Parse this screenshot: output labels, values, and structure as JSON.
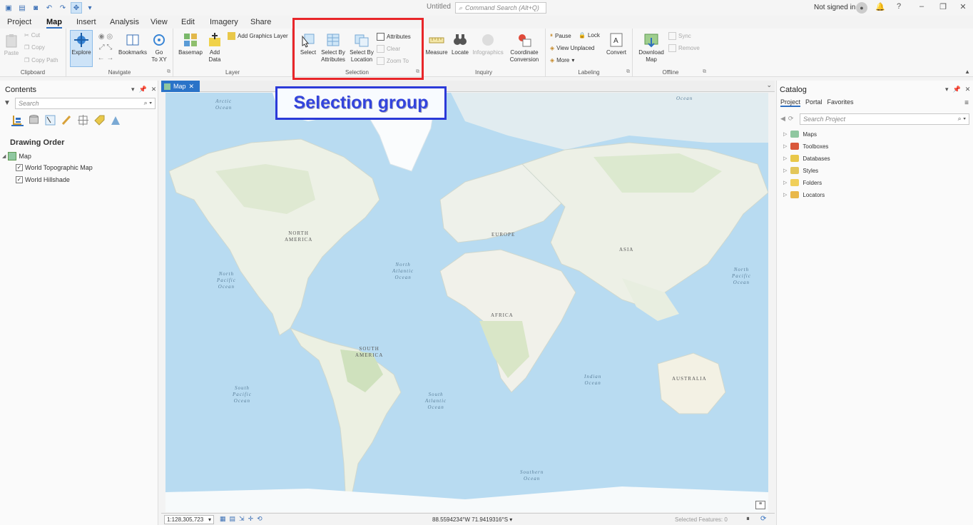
{
  "window": {
    "title": "Untitled",
    "command_search_placeholder": "Command Search (Alt+Q)",
    "signin_text": "Not signed in"
  },
  "tabs": [
    "Project",
    "Map",
    "Insert",
    "Analysis",
    "View",
    "Edit",
    "Imagery",
    "Share"
  ],
  "active_tab": "Map",
  "ribbon": {
    "clipboard": {
      "label": "Clipboard",
      "paste": "Paste",
      "cut": "Cut",
      "copy": "Copy",
      "copy_path": "Copy Path"
    },
    "navigate": {
      "label": "Navigate",
      "explore": "Explore",
      "bookmarks": "Bookmarks",
      "go_to": "Go",
      "go_to_2": "To XY"
    },
    "layer": {
      "label": "Layer",
      "basemap": "Basemap",
      "add": "Add",
      "add_2": "Data",
      "add_graphics_layer": "Add Graphics Layer"
    },
    "selection": {
      "label": "Selection",
      "select": "Select",
      "select_by_attr_1": "Select By",
      "select_by_attr_2": "Attributes",
      "select_by_loc_1": "Select By",
      "select_by_loc_2": "Location",
      "attributes": "Attributes",
      "clear": "Clear",
      "zoom_to": "Zoom To"
    },
    "inquiry": {
      "label": "Inquiry",
      "measure": "Measure",
      "locate": "Locate",
      "infographics": "Infographics",
      "coord_1": "Coordinate",
      "coord_2": "Conversion"
    },
    "labeling": {
      "label": "Labeling",
      "pause": "Pause",
      "lock": "Lock",
      "view_unplaced": "View Unplaced",
      "more": "More",
      "convert": "Convert"
    },
    "offline": {
      "label": "Offline",
      "download_1": "Download",
      "download_2": "Map",
      "sync": "Sync",
      "remove": "Remove"
    }
  },
  "annotation": {
    "callout_text": "Selection group"
  },
  "contents": {
    "title": "Contents",
    "search_placeholder": "Search",
    "drawing_order": "Drawing Order",
    "map_name": "Map",
    "layers": [
      "World Topographic Map",
      "World Hillshade"
    ]
  },
  "map": {
    "tab_label": "Map",
    "ocean_labels": {
      "arctic": [
        "Arctic",
        "Ocean"
      ],
      "arctic_right": [
        "Ocean"
      ],
      "north_atlantic": [
        "North",
        "Atlantic",
        "Ocean"
      ],
      "north_pacific_left": [
        "North",
        "Pacific",
        "Ocean"
      ],
      "north_pacific_right": [
        "North",
        "Pacific",
        "Ocean"
      ],
      "south_pacific": [
        "South",
        "Pacific",
        "Ocean"
      ],
      "south_atlantic": [
        "South",
        "Atlantic",
        "Ocean"
      ],
      "indian": [
        "Indian",
        "Ocean"
      ],
      "southern": [
        "Southern",
        "Ocean"
      ]
    },
    "continent_labels": {
      "north_america": [
        "NORTH",
        "AMERICA"
      ],
      "south_america": [
        "SOUTH",
        "AMERICA"
      ],
      "europe": [
        "EUROPE"
      ],
      "africa": [
        "AFRICA"
      ],
      "asia": [
        "ASIA"
      ],
      "australia": [
        "AUSTRALIA"
      ]
    }
  },
  "statusbar": {
    "scale": "1:128,305,723",
    "coordinates": "88.5594234°W 71.9419316°S",
    "selected_features": "Selected Features: 0"
  },
  "catalog": {
    "title": "Catalog",
    "tabs": [
      "Project",
      "Portal",
      "Favorites"
    ],
    "search_placeholder": "Search Project",
    "items": [
      "Maps",
      "Toolboxes",
      "Databases",
      "Styles",
      "Folders",
      "Locators"
    ]
  }
}
